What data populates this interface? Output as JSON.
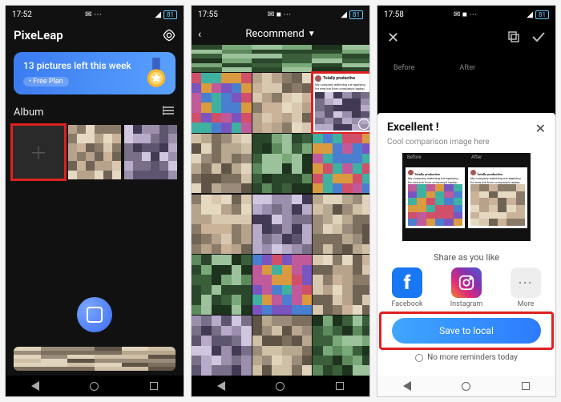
{
  "screen1": {
    "status": {
      "time": "17:52",
      "battery": "81"
    },
    "app_name": "PixeLeap",
    "banner": {
      "title": "13 pictures left this week",
      "plan_label": "Free Plan"
    },
    "album_label": "Album",
    "nav": {
      "back": "tri",
      "home": "circ",
      "recent": "sq"
    }
  },
  "screen2": {
    "status": {
      "time": "17:55",
      "battery": "81"
    },
    "header": {
      "back": "‹",
      "title": "Recommend",
      "caret": "▼"
    },
    "meme": {
      "user": "Totally productive",
      "caption": "My company watching me applying for new job from company's laptop"
    }
  },
  "screen3": {
    "status": {
      "time": "17:58",
      "battery": "81"
    },
    "labels": {
      "before": "Before",
      "after": "After"
    },
    "sheet": {
      "title": "Excellent !",
      "subtitle": "Cool comparison image here",
      "share_heading": "Share as you like",
      "apps": {
        "facebook": "Facebook",
        "instagram": "Instagram",
        "more": "More"
      },
      "save_button": "Save to local",
      "reminder": "No more reminders today"
    },
    "card": {
      "user": "Totally productive",
      "caption": "My company watching me applying for new job from company's laptop"
    }
  }
}
